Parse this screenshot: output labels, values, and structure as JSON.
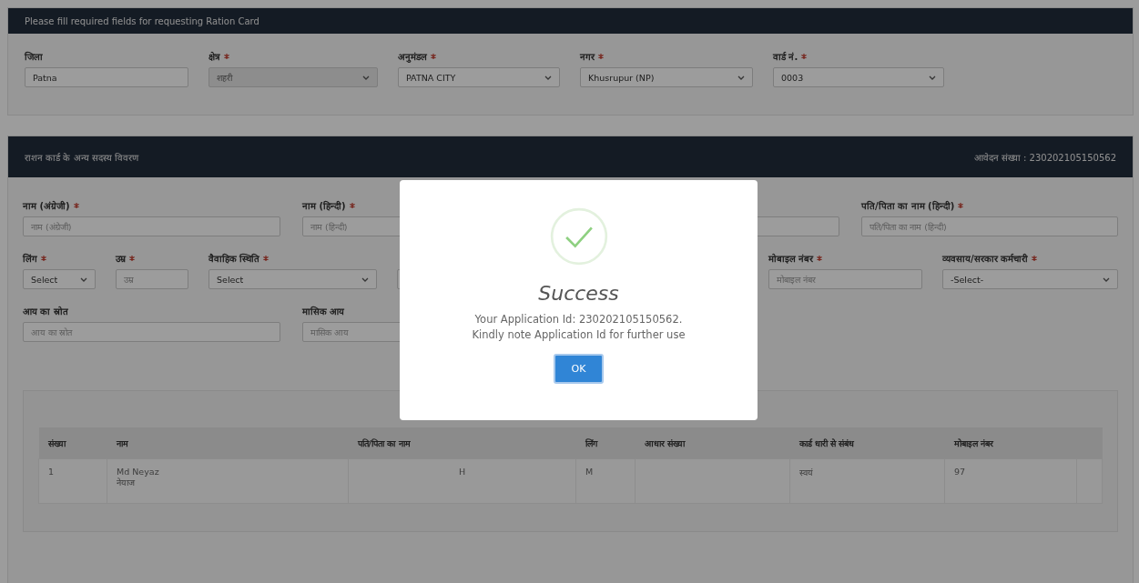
{
  "header": {
    "title": "Please fill required fields for requesting Ration Card"
  },
  "location_fields": [
    {
      "label": "जिला",
      "required": false,
      "kind": "text",
      "value": "Patna",
      "disabled": false
    },
    {
      "label": "क्षेत्र",
      "required": true,
      "kind": "select",
      "value": "शहरी",
      "disabled": true
    },
    {
      "label": "अनुमंडल",
      "required": true,
      "kind": "select",
      "value": "PATNA CITY",
      "disabled": false
    },
    {
      "label": "नगर",
      "required": true,
      "kind": "select",
      "value": "Khusrupur (NP)",
      "disabled": false
    },
    {
      "label": "वार्ड नं.",
      "required": true,
      "kind": "select",
      "value": "0003",
      "disabled": false
    }
  ],
  "members_section": {
    "title": "राशन कार्ड के अन्य सदस्य विवरण",
    "application_number": "आवेदन संख्या : 230202105150562"
  },
  "member_rows": [
    [
      {
        "label": "नाम (अंग्रेजी)",
        "required": true,
        "kind": "text",
        "placeholder": "नाम (अंग्रेजी)"
      },
      {
        "label": "नाम (हिन्दी)",
        "required": true,
        "kind": "text",
        "placeholder": "नाम (हिन्दी)"
      },
      {
        "kind": "text"
      },
      {
        "label": "पति/पिता का नाम (हिन्दी)",
        "required": true,
        "kind": "text",
        "placeholder": "पति/पिता का नाम (हिन्दी)"
      }
    ],
    [
      {
        "label": "लिंग",
        "required": true,
        "kind": "select",
        "value": "Select"
      },
      {
        "label": "उम्र",
        "required": true,
        "kind": "text",
        "placeholder": "उम्र"
      },
      {
        "label": "वैवाहिक स्थिति",
        "required": true,
        "kind": "select",
        "value": "Select"
      },
      {
        "kind": "text"
      },
      {
        "label": "मोबाइल नंबर",
        "required": true,
        "kind": "text",
        "placeholder": "मोबाइल नंबर"
      },
      {
        "label": "व्यवसाय/सरकार कर्मचारी",
        "required": true,
        "kind": "select",
        "value": "-Select-"
      }
    ],
    [
      {
        "label": "आय का स्रोत",
        "required": false,
        "kind": "text",
        "placeholder": "आय का स्रोत"
      },
      {
        "label": "मासिक आय",
        "required": false,
        "kind": "text",
        "placeholder": "मासिक आय"
      }
    ]
  ],
  "table": {
    "columns": [
      "संख्या",
      "नाम",
      "पति/पिता का नाम",
      "लिंग",
      "आधार संख्या",
      "कार्ड धारी से संबंध",
      "मोबाइल नंबर"
    ],
    "rows": [
      {
        "cells": [
          [
            "1"
          ],
          [
            "Md Neyaz",
            "नेयाज"
          ],
          [
            "H"
          ],
          [
            "M"
          ],
          [],
          [
            "स्वयं"
          ],
          [
            "97"
          ]
        ]
      }
    ]
  },
  "dialog": {
    "title": "Success",
    "message_lines": [
      "Your Application Id: 230202105150562.",
      "Kindly note Application Id for further use"
    ],
    "button": "OK"
  }
}
